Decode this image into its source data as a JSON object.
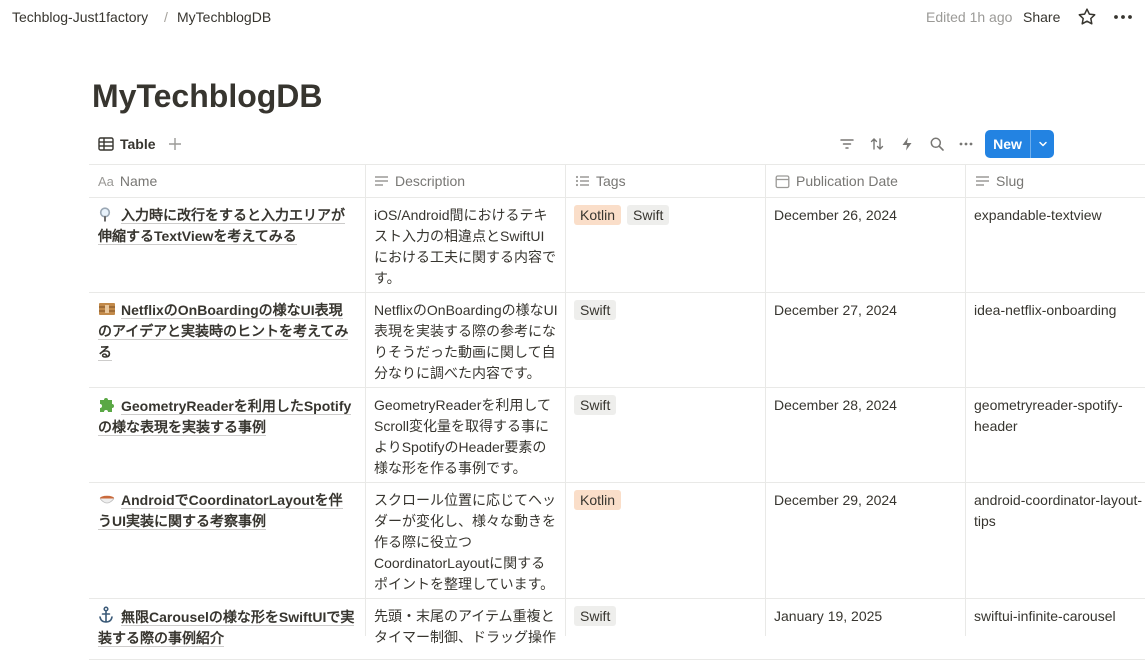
{
  "breadcrumb": {
    "workspace": "Techblog-Just1factory",
    "separator": "/",
    "page": "MyTechblogDB"
  },
  "topbar": {
    "edited": "Edited 1h ago",
    "share": "Share"
  },
  "page_title": "MyTechblogDB",
  "view": {
    "tab_label": "Table",
    "new_label": "New"
  },
  "columns": {
    "name": "Name",
    "description": "Description",
    "tags": "Tags",
    "publication_date": "Publication Date",
    "slug": "Slug"
  },
  "colors": {
    "accent": "#2383e2",
    "tag_kotlin": "#fadec9",
    "tag_swift": "#eeeeec",
    "text": "#37352f",
    "muted": "#787774"
  },
  "rows": [
    {
      "icon": "mag-icon",
      "name": "入力時に改行をすると入力エリアが伸縮するTextViewを考えてみる",
      "description": "iOS/Android間におけるテキスト入力の相違点とSwiftUIにおける工夫に関する内容です。",
      "tags": [
        "Kotlin",
        "Swift"
      ],
      "date": "December 26, 2024",
      "slug": "expandable-textview"
    },
    {
      "icon": "box-icon",
      "name": "NetflixのOnBoardingの様なUI表現のアイデアと実装時のヒントを考えてみる",
      "description": "NetflixのOnBoardingの様なUI表現を実装する際の参考になりそうだった動画に関して自分なりに調べた内容です。",
      "tags": [
        "Swift"
      ],
      "date": "December 27, 2024",
      "slug": "idea-netflix-onboarding"
    },
    {
      "icon": "puzzle-icon",
      "name": "GeometryReaderを利用したSpotifyの様な表現を実装する事例",
      "description": "GeometryReaderを利用してScroll変化量を取得する事によりSpotifyのHeader要素の様な形を作る事例です。",
      "tags": [
        "Swift"
      ],
      "date": "December 28, 2024",
      "slug": "geometryreader-spotify-header"
    },
    {
      "icon": "bowl-icon",
      "name": "AndroidでCoordinatorLayoutを伴うUI実装に関する考察事例",
      "description": "スクロール位置に応じてヘッダーが変化し、様々な動きを作る際に役立つCoordinatorLayoutに関するポイントを整理しています。",
      "tags": [
        "Kotlin"
      ],
      "date": "December 29, 2024",
      "slug": "android-coordinator-layout-tips"
    },
    {
      "icon": "anchor-icon",
      "name": "無限Carouselの様な形をSwiftUIで実装する際の事例紹介",
      "description": "先頭・末尾のアイテム重複とタイマー制御、ドラッグ操作",
      "tags": [
        "Swift"
      ],
      "date": "January 19, 2025",
      "slug": "swiftui-infinite-carousel"
    }
  ]
}
